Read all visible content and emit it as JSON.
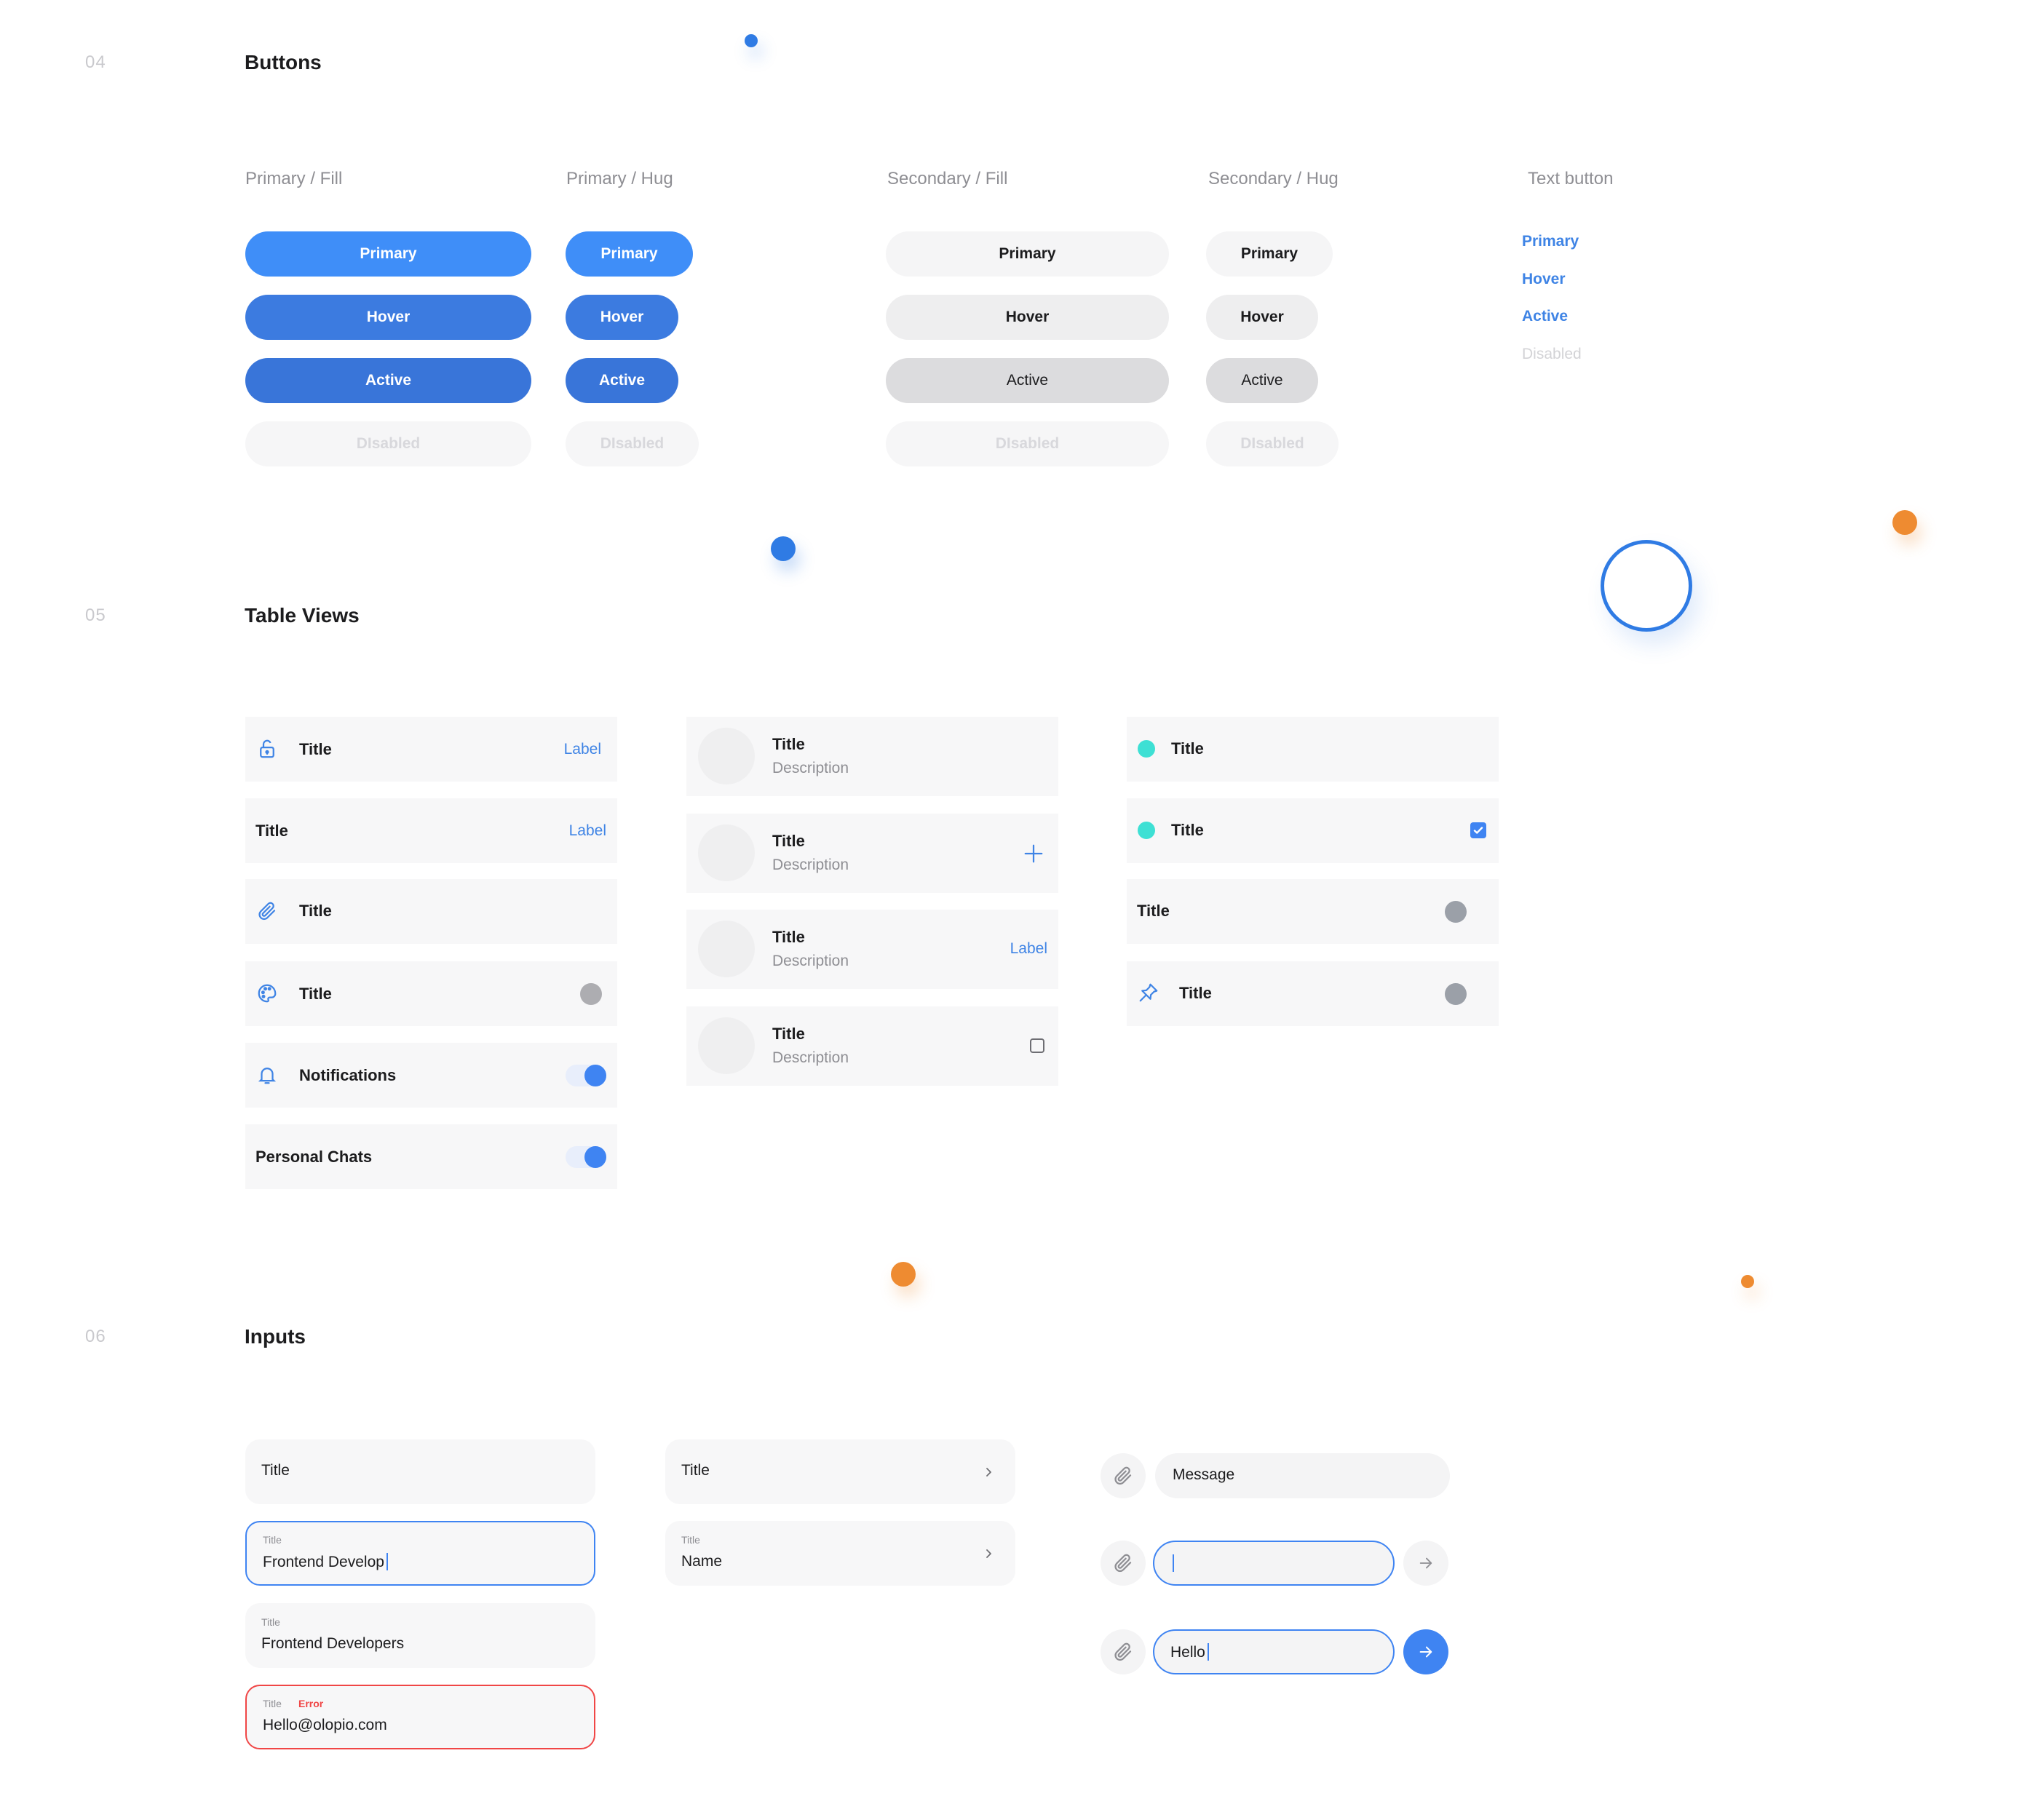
{
  "sections": {
    "buttons": {
      "number": "04",
      "title": "Buttons"
    },
    "tables": {
      "number": "05",
      "title": "Table Views"
    },
    "inputs": {
      "number": "06",
      "title": "Inputs"
    }
  },
  "colors": {
    "primary": "#3f8ef8",
    "primary_hover": "#3c7be0",
    "primary_active": "#3975d9",
    "accent_blue": "#2f7be4",
    "accent_orange": "#ee8b31",
    "teal": "#3ee0d4",
    "error": "#f04646"
  },
  "button_columns": {
    "primary_fill": "Primary / Fill",
    "primary_hug": "Primary / Hug",
    "secondary_fill": "Secondary / Fill",
    "secondary_hug": "Secondary / Hug",
    "text_button": "Text button"
  },
  "button_states": {
    "primary": "Primary",
    "hover": "Hover",
    "active": "Active",
    "disabled_fill": "DIsabled",
    "disabled_text": "Disabled"
  },
  "table_col1": [
    {
      "icon": "unlock-icon",
      "title": "Title",
      "label": "Label"
    },
    {
      "title": "Title",
      "label": "Label"
    },
    {
      "icon": "paperclip-icon",
      "title": "Title"
    },
    {
      "icon": "palette-icon",
      "title": "Title"
    },
    {
      "icon": "bell-icon",
      "title": "Notifications",
      "toggle": "on"
    },
    {
      "title": "Personal Chats",
      "toggle": "on"
    }
  ],
  "table_col2": [
    {
      "title": "Title",
      "description": "Description"
    },
    {
      "title": "Title",
      "description": "Description",
      "accessory": "plus-icon"
    },
    {
      "title": "Title",
      "description": "Description",
      "label": "Label"
    },
    {
      "title": "Title",
      "description": "Description",
      "accessory": "checkbox-unchecked"
    }
  ],
  "table_col3": [
    {
      "title": "Title",
      "bullet": "teal-dot"
    },
    {
      "title": "Title",
      "bullet": "teal-dot",
      "accessory": "checkbox-checked"
    },
    {
      "title": "Title",
      "accessory": "grey-dot"
    },
    {
      "icon": "pin-icon",
      "title": "Title",
      "accessory": "grey-dot"
    }
  ],
  "inputs_col1": [
    {
      "placeholder": "Title"
    },
    {
      "label": "Title",
      "value": "Frontend Develop",
      "state": "focused"
    },
    {
      "label": "Title",
      "value": "Frontend Developers"
    },
    {
      "label": "Title",
      "error": "Error",
      "value": "Hello@olopio.com",
      "state": "error"
    }
  ],
  "inputs_col2": [
    {
      "placeholder": "Title",
      "icon": "chevron-right-icon"
    },
    {
      "label": "Title",
      "value": "Name",
      "icon": "chevron-right-icon"
    }
  ],
  "chat_inputs": [
    {
      "placeholder": "Message",
      "attach_icon": "paperclip-icon"
    },
    {
      "value": "",
      "state": "focused",
      "attach_icon": "paperclip-icon",
      "send_icon": "arrow-right-icon"
    },
    {
      "value": "Hello",
      "state": "focused",
      "attach_icon": "paperclip-icon",
      "send_icon": "arrow-right-icon",
      "send_active": true
    }
  ]
}
